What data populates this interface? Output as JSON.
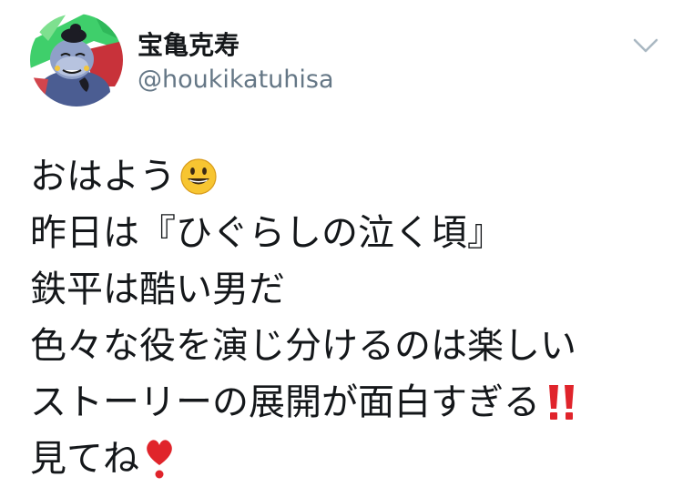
{
  "tweet": {
    "user": {
      "display_name": "宝亀克寿",
      "handle": "@houkikatuhisa",
      "avatar_icon": "character-avatar-icon"
    },
    "menu_icon": "chevron-down-icon",
    "body_lines": [
      {
        "text": "おはよう",
        "emoji": "grinning-face-emoji"
      },
      {
        "text": "昨日は『ひぐらしの泣く頃』",
        "emoji": null
      },
      {
        "text": "鉄平は酷い男だ",
        "emoji": null
      },
      {
        "text": "色々な役を演じ分けるのは楽しい",
        "emoji": null
      },
      {
        "text": "ストーリーの展開が面白すぎる",
        "emoji": "double-exclamation-emoji"
      },
      {
        "text": "見てね",
        "emoji": "heart-exclamation-emoji"
      }
    ]
  },
  "colors": {
    "text": "#14171a",
    "secondary_text": "#657786",
    "chevron": "#aab8c2",
    "exclamation_red": "#e0242b",
    "emoji_yellow": "#f7c531"
  }
}
